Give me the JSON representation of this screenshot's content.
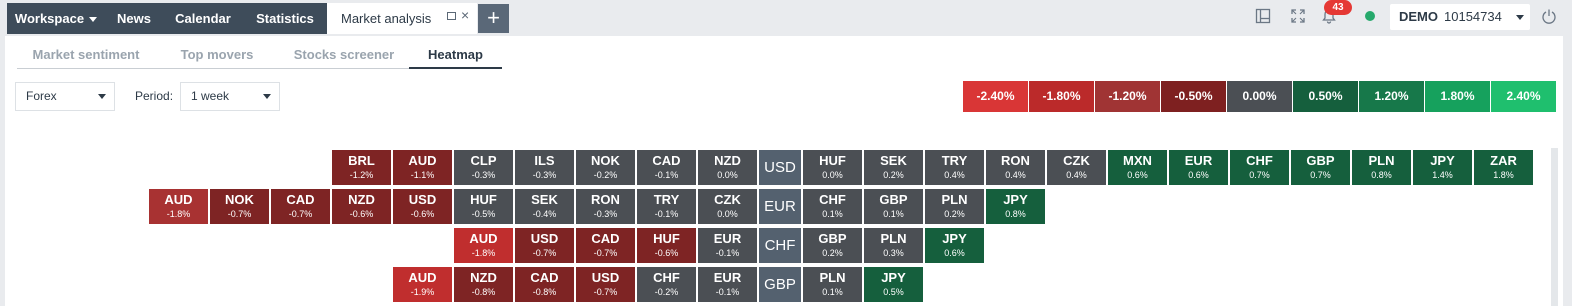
{
  "topbar": {
    "tabs": [
      {
        "label": "Workspace",
        "has_caret": true,
        "active": false
      },
      {
        "label": "News",
        "active": false
      },
      {
        "label": "Calendar",
        "active": false
      },
      {
        "label": "Statistics",
        "active": false
      },
      {
        "label": "Market analysis",
        "active": true
      }
    ],
    "plus_symbol": "+",
    "close_symbol": "×",
    "notification_count": "43",
    "account": {
      "mode": "DEMO",
      "number": "10154734"
    },
    "icons": [
      "layout-icon",
      "fullscreen-icon",
      "bell-icon",
      "status-dot",
      "power-icon"
    ],
    "status_color": "#26a96c"
  },
  "subtabs": [
    "Market sentiment",
    "Top movers",
    "Stocks screener",
    "Heatmap"
  ],
  "active_subtab": "Heatmap",
  "filters": {
    "asset_class": "Forex",
    "period_label": "Period:",
    "period_value": "1 week"
  },
  "legend": [
    {
      "label": "-2.40%",
      "color": "#d93636"
    },
    {
      "label": "-1.80%",
      "color": "#bb2a2a"
    },
    {
      "label": "-1.20%",
      "color": "#a03434"
    },
    {
      "label": "-0.50%",
      "color": "#7e2020"
    },
    {
      "label": "0.00%",
      "color": "#4b4f54"
    },
    {
      "label": "0.50%",
      "color": "#155f3d"
    },
    {
      "label": "1.20%",
      "color": "#17784a"
    },
    {
      "label": "1.80%",
      "color": "#16a15d"
    },
    {
      "label": "2.40%",
      "color": "#1fbf6e"
    }
  ],
  "heatmap": [
    {
      "base": "USD",
      "left": [
        {
          "code": "BRL",
          "chg": "-1.2%",
          "color": "#7e2424"
        },
        {
          "code": "AUD",
          "chg": "-1.1%",
          "color": "#7e2424"
        },
        {
          "code": "CLP",
          "chg": "-0.3%",
          "color": "#4b4f54"
        },
        {
          "code": "ILS",
          "chg": "-0.3%",
          "color": "#4b4f54"
        },
        {
          "code": "NOK",
          "chg": "-0.2%",
          "color": "#4b4f54"
        },
        {
          "code": "CAD",
          "chg": "-0.1%",
          "color": "#4b4f54"
        },
        {
          "code": "NZD",
          "chg": "0.0%",
          "color": "#4b4f54"
        }
      ],
      "right": [
        {
          "code": "HUF",
          "chg": "0.0%",
          "color": "#4b4f54"
        },
        {
          "code": "SEK",
          "chg": "0.2%",
          "color": "#4b4f54"
        },
        {
          "code": "TRY",
          "chg": "0.4%",
          "color": "#4b4f54"
        },
        {
          "code": "RON",
          "chg": "0.4%",
          "color": "#4b4f54"
        },
        {
          "code": "CZK",
          "chg": "0.4%",
          "color": "#4b4f54"
        },
        {
          "code": "MXN",
          "chg": "0.6%",
          "color": "#155f3d"
        },
        {
          "code": "EUR",
          "chg": "0.6%",
          "color": "#155f3d"
        },
        {
          "code": "CHF",
          "chg": "0.7%",
          "color": "#155f3d"
        },
        {
          "code": "GBP",
          "chg": "0.7%",
          "color": "#155f3d"
        },
        {
          "code": "PLN",
          "chg": "0.8%",
          "color": "#155f3d"
        },
        {
          "code": "JPY",
          "chg": "1.4%",
          "color": "#155f3d"
        },
        {
          "code": "ZAR",
          "chg": "1.8%",
          "color": "#155f3d"
        }
      ]
    },
    {
      "base": "EUR",
      "left": [
        {
          "code": "AUD",
          "chg": "-1.8%",
          "color": "#a83232"
        },
        {
          "code": "NOK",
          "chg": "-0.7%",
          "color": "#7e2424"
        },
        {
          "code": "CAD",
          "chg": "-0.7%",
          "color": "#7e2424"
        },
        {
          "code": "NZD",
          "chg": "-0.6%",
          "color": "#7e2424"
        },
        {
          "code": "USD",
          "chg": "-0.6%",
          "color": "#7e2424"
        },
        {
          "code": "HUF",
          "chg": "-0.5%",
          "color": "#4b4f54"
        },
        {
          "code": "SEK",
          "chg": "-0.4%",
          "color": "#4b4f54"
        },
        {
          "code": "RON",
          "chg": "-0.3%",
          "color": "#4b4f54"
        },
        {
          "code": "TRY",
          "chg": "-0.1%",
          "color": "#4b4f54"
        },
        {
          "code": "CZK",
          "chg": "0.0%",
          "color": "#4b4f54"
        }
      ],
      "right": [
        {
          "code": "CHF",
          "chg": "0.1%",
          "color": "#4b4f54"
        },
        {
          "code": "GBP",
          "chg": "0.1%",
          "color": "#4b4f54"
        },
        {
          "code": "PLN",
          "chg": "0.2%",
          "color": "#4b4f54"
        },
        {
          "code": "JPY",
          "chg": "0.8%",
          "color": "#155f3d"
        }
      ]
    },
    {
      "base": "CHF",
      "left": [
        {
          "code": "AUD",
          "chg": "-1.8%",
          "color": "#c02e2e"
        },
        {
          "code": "USD",
          "chg": "-0.7%",
          "color": "#7e2424"
        },
        {
          "code": "CAD",
          "chg": "-0.7%",
          "color": "#7e2424"
        },
        {
          "code": "HUF",
          "chg": "-0.6%",
          "color": "#7e2424"
        },
        {
          "code": "EUR",
          "chg": "-0.1%",
          "color": "#4b4f54"
        }
      ],
      "right": [
        {
          "code": "GBP",
          "chg": "0.2%",
          "color": "#4b4f54"
        },
        {
          "code": "PLN",
          "chg": "0.3%",
          "color": "#4b4f54"
        },
        {
          "code": "JPY",
          "chg": "0.6%",
          "color": "#155f3d"
        }
      ]
    },
    {
      "base": "GBP",
      "left": [
        {
          "code": "AUD",
          "chg": "-1.9%",
          "color": "#c02e2e"
        },
        {
          "code": "NZD",
          "chg": "-0.8%",
          "color": "#7e2424"
        },
        {
          "code": "CAD",
          "chg": "-0.8%",
          "color": "#7e2424"
        },
        {
          "code": "USD",
          "chg": "-0.7%",
          "color": "#7e2424"
        },
        {
          "code": "CHF",
          "chg": "-0.2%",
          "color": "#4b4f54"
        },
        {
          "code": "EUR",
          "chg": "-0.1%",
          "color": "#4b4f54"
        }
      ],
      "right": [
        {
          "code": "PLN",
          "chg": "0.1%",
          "color": "#4b4f54"
        },
        {
          "code": "JPY",
          "chg": "0.5%",
          "color": "#155f3d"
        }
      ]
    }
  ]
}
